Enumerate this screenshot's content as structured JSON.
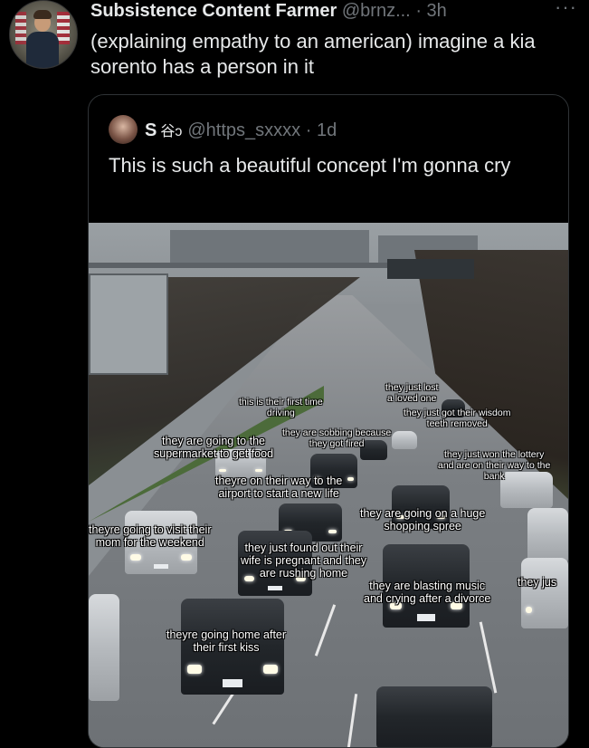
{
  "tweet": {
    "display_name": "Subsistence Content Farmer",
    "handle": "@brnz...",
    "dot": "·",
    "time": "3h",
    "more": "···",
    "text": "(explaining empathy to an american) imagine a kia sorento has a person in it"
  },
  "quote": {
    "display_name": "S",
    "name_emoji": "⾕ↄ",
    "handle": "@https_sxxxx",
    "dot": "·",
    "time": "1d",
    "text": "This is such a beautiful concept I'm gonna cry"
  },
  "image_captions": [
    "they just lost\na loved one",
    "this is their first time\ndriving",
    "they just got their wisdom\nteeth removed",
    "they are sobbing because\nthey got fired",
    "they are going to the\nsupermarket to get food",
    "they just won the lottery\nand are on their way to the\nbank",
    "theyre on their way to the\nairport to start a new life",
    "they are going on a huge\nshopping spree",
    "theyre going to visit their\nmom for the weekend",
    "they just found out their\nwife is pregnant and they\nare rushing home",
    "they are blasting music\nand crying after a divorce",
    "they jus",
    "theyre going home after\ntheir first kiss"
  ]
}
